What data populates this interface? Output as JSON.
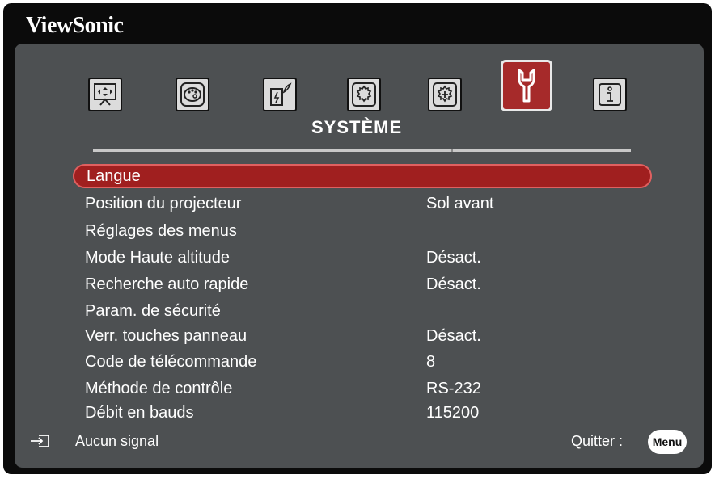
{
  "brand": "ViewSonic",
  "section_title": "SYSTÈME",
  "tabs": [
    {
      "icon": "display-icon",
      "active": false
    },
    {
      "icon": "palette-icon",
      "active": false
    },
    {
      "icon": "power-icon",
      "active": false
    },
    {
      "icon": "gear-icon",
      "active": false
    },
    {
      "icon": "advanced-gear-icon",
      "active": false
    },
    {
      "icon": "wrench-icon",
      "active": true
    },
    {
      "icon": "info-icon",
      "active": false
    }
  ],
  "menu": [
    {
      "label": "Langue",
      "value": ""
    },
    {
      "label": "Position du projecteur",
      "value": "Sol avant"
    },
    {
      "label": "Réglages des menus",
      "value": ""
    },
    {
      "label": "Mode Haute altitude",
      "value": "Désact."
    },
    {
      "label": "Recherche auto rapide",
      "value": "Désact."
    },
    {
      "label": "Param. de sécurité",
      "value": ""
    },
    {
      "label": "Verr. touches panneau",
      "value": "Désact."
    },
    {
      "label": "Code de télécommande",
      "value": "8"
    },
    {
      "label": "Méthode de contrôle",
      "value": "RS-232"
    },
    {
      "label": "Débit en bauds",
      "value": "115200"
    }
  ],
  "selected_index": 0,
  "footer": {
    "source_label": "Aucun signal",
    "quit_label": "Quitter :",
    "menu_button": "Menu"
  },
  "colors": {
    "accent": "#a01f1f",
    "panel": "#4d5052",
    "frame": "#0b0b0b"
  }
}
